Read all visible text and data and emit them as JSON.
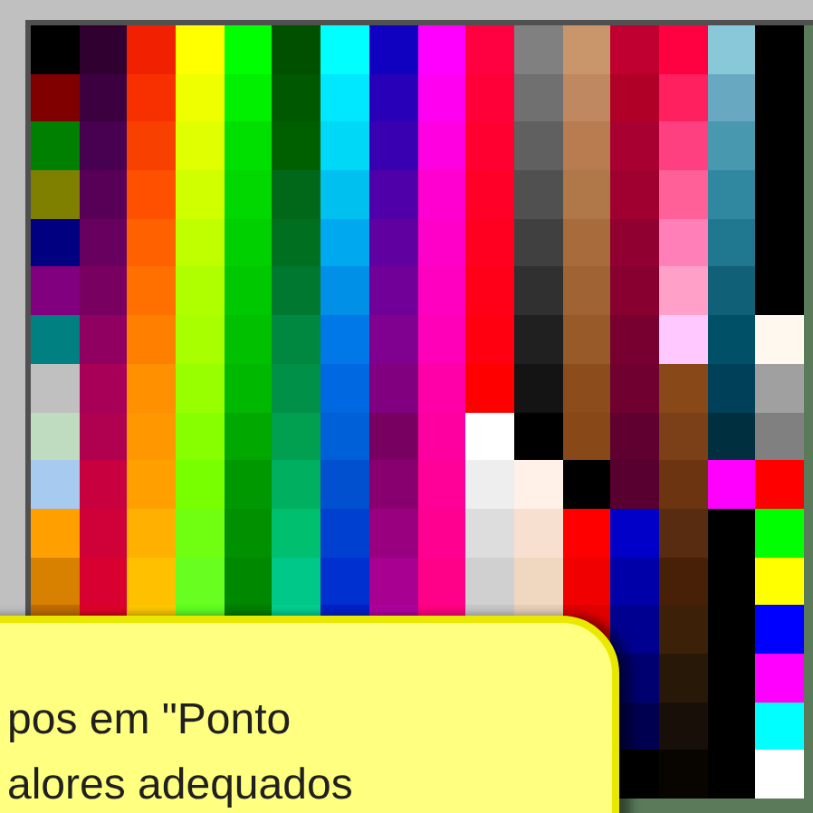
{
  "palette": [
    {
      "swatches": [
        {
          "color": "#000000"
        },
        {
          "color": "#800000"
        },
        {
          "color": "#008000"
        },
        {
          "color": "#808000"
        },
        {
          "color": "#000080"
        },
        {
          "color": "#800080"
        },
        {
          "color": "#008080"
        },
        {
          "color": "#c0c0c0"
        },
        {
          "color": "#c0dcc0"
        },
        {
          "color": "#a6caf0"
        },
        {
          "color": "#ffa000"
        },
        {
          "color": "#d88000"
        },
        {
          "color": "#c06c00"
        }
      ]
    },
    {
      "swatches": [
        {
          "color": "#300030"
        },
        {
          "color": "#3c0040"
        },
        {
          "color": "#480050"
        },
        {
          "color": "#580058"
        },
        {
          "color": "#680060"
        },
        {
          "color": "#780060"
        },
        {
          "color": "#900060"
        },
        {
          "color": "#a80058"
        },
        {
          "color": "#b00050"
        },
        {
          "color": "#c80040"
        },
        {
          "color": "#d00038"
        },
        {
          "color": "#d80030"
        },
        {
          "color": "#e00028"
        }
      ]
    },
    {
      "swatches": [
        {
          "color": "#f02000"
        },
        {
          "color": "#f83000"
        },
        {
          "color": "#f84000"
        },
        {
          "color": "#ff5000"
        },
        {
          "color": "#ff6000"
        },
        {
          "color": "#ff7000"
        },
        {
          "color": "#ff8000"
        },
        {
          "color": "#ff9000"
        },
        {
          "color": "#ff9800"
        },
        {
          "color": "#ffa000"
        },
        {
          "color": "#ffb000"
        },
        {
          "color": "#ffc000"
        },
        {
          "color": "#ffc800"
        }
      ]
    },
    {
      "swatches": [
        {
          "color": "#ffff00"
        },
        {
          "color": "#f0ff00"
        },
        {
          "color": "#e0ff00"
        },
        {
          "color": "#d0ff00"
        },
        {
          "color": "#c0ff00"
        },
        {
          "color": "#b0ff00"
        },
        {
          "color": "#a8ff00"
        },
        {
          "color": "#98ff00"
        },
        {
          "color": "#88ff00"
        },
        {
          "color": "#78ff00"
        },
        {
          "color": "#70ff10"
        },
        {
          "color": "#68ff20"
        },
        {
          "color": "#60ff20"
        }
      ]
    },
    {
      "swatches": [
        {
          "color": "#00ff00"
        },
        {
          "color": "#00f000"
        },
        {
          "color": "#00e000"
        },
        {
          "color": "#00d800"
        },
        {
          "color": "#00d000"
        },
        {
          "color": "#00c800"
        },
        {
          "color": "#00c000"
        },
        {
          "color": "#00b800"
        },
        {
          "color": "#00a800"
        },
        {
          "color": "#009800"
        },
        {
          "color": "#009000"
        },
        {
          "color": "#008800"
        },
        {
          "color": "#008000"
        }
      ]
    },
    {
      "swatches": [
        {
          "color": "#005000"
        },
        {
          "color": "#005800"
        },
        {
          "color": "#006000"
        },
        {
          "color": "#006818"
        },
        {
          "color": "#007020"
        },
        {
          "color": "#007830"
        },
        {
          "color": "#008840"
        },
        {
          "color": "#009048"
        },
        {
          "color": "#00a050"
        },
        {
          "color": "#00b060"
        },
        {
          "color": "#00c070"
        },
        {
          "color": "#00c888"
        },
        {
          "color": "#00d090"
        }
      ]
    },
    {
      "swatches": [
        {
          "color": "#00ffff"
        },
        {
          "color": "#00e8ff"
        },
        {
          "color": "#00d8f8"
        },
        {
          "color": "#00c0f0"
        },
        {
          "color": "#00a8f0"
        },
        {
          "color": "#0090e8"
        },
        {
          "color": "#0078e8"
        },
        {
          "color": "#0068e0"
        },
        {
          "color": "#0060d8"
        },
        {
          "color": "#0050d0"
        },
        {
          "color": "#0040d0"
        },
        {
          "color": "#0030d0"
        },
        {
          "color": "#0020c8"
        }
      ]
    },
    {
      "swatches": [
        {
          "color": "#1000c0"
        },
        {
          "color": "#2800b8"
        },
        {
          "color": "#3800b0"
        },
        {
          "color": "#5000a8"
        },
        {
          "color": "#6000a0"
        },
        {
          "color": "#700098"
        },
        {
          "color": "#800090"
        },
        {
          "color": "#800080"
        },
        {
          "color": "#780060"
        },
        {
          "color": "#880070"
        },
        {
          "color": "#980080"
        },
        {
          "color": "#a80090"
        },
        {
          "color": "#b000a0"
        }
      ]
    },
    {
      "swatches": [
        {
          "color": "#ff00ff"
        },
        {
          "color": "#ff00f0"
        },
        {
          "color": "#ff00e0"
        },
        {
          "color": "#ff00d0"
        },
        {
          "color": "#ff00c8"
        },
        {
          "color": "#ff00c0"
        },
        {
          "color": "#ff00b8"
        },
        {
          "color": "#ff00a8"
        },
        {
          "color": "#ff00a0"
        },
        {
          "color": "#ff0098"
        },
        {
          "color": "#ff0090"
        },
        {
          "color": "#ff0088"
        },
        {
          "color": "#ff0080"
        }
      ]
    },
    {
      "swatches": [
        {
          "color": "#ff0040"
        },
        {
          "color": "#ff0038"
        },
        {
          "color": "#ff0030"
        },
        {
          "color": "#ff0028"
        },
        {
          "color": "#ff0020"
        },
        {
          "color": "#ff0018"
        },
        {
          "color": "#ff0010"
        },
        {
          "color": "#ff0000"
        },
        {
          "color": "#ffffff"
        },
        {
          "color": "#eeeeee"
        },
        {
          "color": "#dddddd"
        },
        {
          "color": "#d0d0d0"
        },
        {
          "color": "#c8c8c8"
        }
      ]
    },
    {
      "swatches": [
        {
          "color": "#808080"
        },
        {
          "color": "#707070"
        },
        {
          "color": "#606060"
        },
        {
          "color": "#505050"
        },
        {
          "color": "#404040"
        },
        {
          "color": "#303030"
        },
        {
          "color": "#202020"
        },
        {
          "color": "#141414"
        },
        {
          "color": "#000000"
        },
        {
          "color": "#fff0e8"
        },
        {
          "color": "#f8e0d0"
        },
        {
          "color": "#f0d8c0"
        },
        {
          "color": "#e8d0b8"
        }
      ]
    },
    {
      "swatches": [
        {
          "color": "#c8966a"
        },
        {
          "color": "#c08860"
        },
        {
          "color": "#b87c50"
        },
        {
          "color": "#b07848"
        },
        {
          "color": "#a86c3c"
        },
        {
          "color": "#a06434"
        },
        {
          "color": "#985a28"
        },
        {
          "color": "#8c4c1c"
        },
        {
          "color": "#884818"
        },
        {
          "color": "#000000"
        },
        {
          "color": "#ff0000"
        },
        {
          "color": "#f00000"
        },
        {
          "color": "#e00000"
        }
      ]
    },
    {
      "swatches": [
        {
          "color": "#c00030"
        },
        {
          "color": "#b00028"
        },
        {
          "color": "#a80030"
        },
        {
          "color": "#a00030"
        },
        {
          "color": "#900030"
        },
        {
          "color": "#880030"
        },
        {
          "color": "#780030"
        },
        {
          "color": "#700030"
        },
        {
          "color": "#600030"
        },
        {
          "color": "#580030"
        },
        {
          "color": "#0000c8"
        },
        {
          "color": "#0000a8"
        },
        {
          "color": "#000090"
        },
        {
          "color": "#000070"
        },
        {
          "color": "#000050"
        },
        {
          "color": "#000000"
        }
      ]
    },
    {
      "swatches": [
        {
          "color": "#ff0040"
        },
        {
          "color": "#ff2060"
        },
        {
          "color": "#ff4080"
        },
        {
          "color": "#ff6098"
        },
        {
          "color": "#ff80b8"
        },
        {
          "color": "#ffa0c8"
        },
        {
          "color": "#ffc8ff"
        },
        {
          "color": "#884818"
        },
        {
          "color": "#7c4018"
        },
        {
          "color": "#6c3410"
        },
        {
          "color": "#582c10"
        },
        {
          "color": "#482008"
        },
        {
          "color": "#3c2008"
        },
        {
          "color": "#281808"
        },
        {
          "color": "#181008"
        },
        {
          "color": "#080400"
        }
      ]
    },
    {
      "swatches": [
        {
          "color": "#88c8d8"
        },
        {
          "color": "#68a8c0"
        },
        {
          "color": "#4898b0"
        },
        {
          "color": "#3088a0"
        },
        {
          "color": "#207890"
        },
        {
          "color": "#106078"
        },
        {
          "color": "#005068"
        },
        {
          "color": "#004058"
        },
        {
          "color": "#003040"
        },
        {
          "color": "#ff00ff"
        },
        {
          "color": "#000000"
        },
        {
          "color": "#000000"
        },
        {
          "color": "#000000"
        },
        {
          "color": "#000000"
        },
        {
          "color": "#000000"
        },
        {
          "color": "#000000"
        }
      ]
    },
    {
      "swatches": [
        {
          "color": "#000000"
        },
        {
          "color": "#000000"
        },
        {
          "color": "#000000"
        },
        {
          "color": "#000000"
        },
        {
          "color": "#000000"
        },
        {
          "color": "#000000"
        },
        {
          "color": "#fff8ee"
        },
        {
          "color": "#a0a0a0"
        },
        {
          "color": "#808080"
        },
        {
          "color": "#ff0000"
        },
        {
          "color": "#00ff00"
        },
        {
          "color": "#ffff00"
        },
        {
          "color": "#0000ff"
        },
        {
          "color": "#ff00ff"
        },
        {
          "color": "#00ffff"
        },
        {
          "color": "#ffffff"
        }
      ]
    }
  ],
  "tooltip": {
    "lines": [
      "pos em \"Ponto",
      "alores adequados"
    ]
  }
}
